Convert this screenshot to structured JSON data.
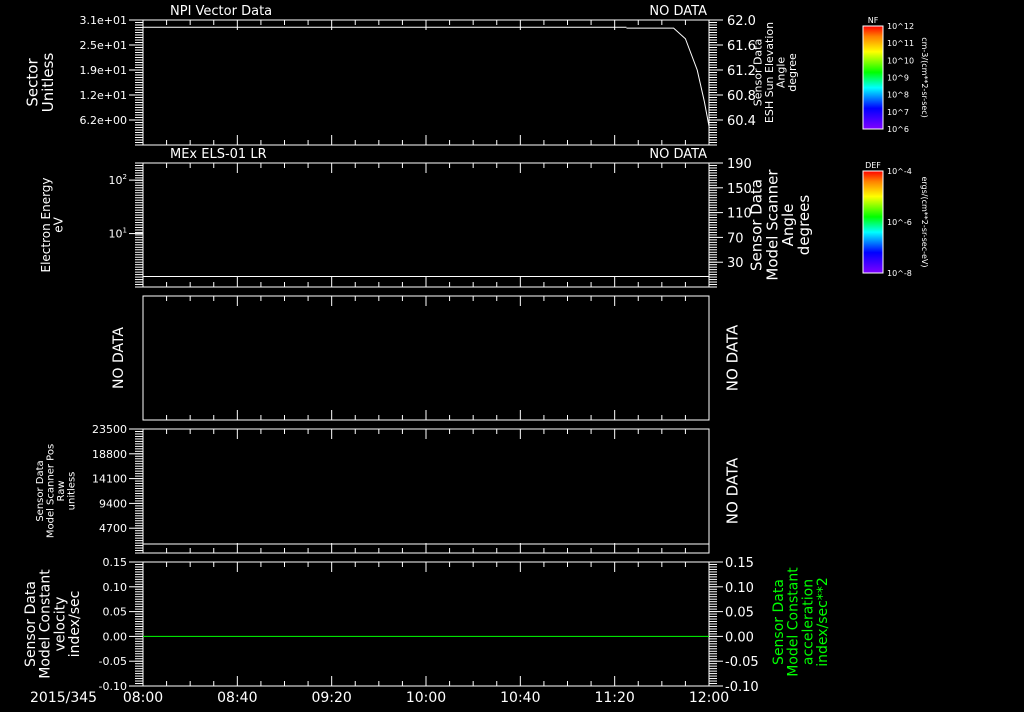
{
  "chart_data": [
    {
      "type": "line",
      "title": "NPI Vector Data",
      "status": "NO DATA",
      "ylabel": "Sector\nUnitless",
      "ylim": [
        0,
        31
      ],
      "yticks": [
        "3.1e+01",
        "2.5e+01",
        "1.9e+01",
        "1.2e+01",
        "6.2e+00"
      ],
      "ytick_values": [
        31,
        24.8,
        18.6,
        12.4,
        6.2
      ],
      "y2label": "Sensor Data\nESH Sun Elevation\nAngle\ndegree",
      "y2lim": [
        60.0,
        62.0
      ],
      "y2ticks": [
        "62.0",
        "61.6",
        "61.2",
        "60.8",
        "60.4"
      ],
      "y2tick_values": [
        62.0,
        61.6,
        61.2,
        60.8,
        60.4
      ],
      "series": [
        {
          "axis": "left",
          "x": [
            "08:00",
            "11:25"
          ],
          "y": [
            29.2,
            29.2
          ]
        },
        {
          "axis": "right",
          "x": [
            "11:25",
            "11:45",
            "11:50",
            "11:55",
            "11:58",
            "12:00"
          ],
          "y": [
            61.87,
            61.87,
            61.7,
            61.2,
            60.7,
            60.3
          ]
        }
      ]
    },
    {
      "type": "line",
      "title": "MEx ELS-01 LR",
      "status": "NO DATA",
      "ylabel": "Electron Energy\neV",
      "yscale": "log",
      "ylim": [
        1,
        209
      ],
      "yticks": [
        "10^2",
        "10^1"
      ],
      "ytick_values": [
        100,
        10
      ],
      "y2label": "Sensor Data\nModel Scanner\nAngle\ndegrees",
      "y2lim": [
        -10,
        190
      ],
      "y2ticks": [
        "190",
        "150",
        "110",
        "70",
        "30"
      ],
      "y2tick_values": [
        190,
        150,
        110,
        70,
        30
      ],
      "series": [
        {
          "axis": "right",
          "x": [
            "08:00",
            "12:00"
          ],
          "y": [
            7,
            7
          ]
        }
      ]
    },
    {
      "type": "line",
      "ylabel": "NO DATA",
      "y2label": "NO DATA",
      "series": []
    },
    {
      "type": "line",
      "ylabel": "Sensor Data\nModel Scanner Pos\nRaw\nunitless",
      "ylim": [
        0,
        23500
      ],
      "yticks": [
        "23500",
        "18800",
        "14100",
        "9400",
        "4700"
      ],
      "ytick_values": [
        23500,
        18800,
        14100,
        9400,
        4700
      ],
      "y2label": "NO DATA",
      "series": [
        {
          "axis": "left",
          "x": [
            "08:00",
            "12:00"
          ],
          "y": [
            1700,
            1700
          ]
        }
      ]
    },
    {
      "type": "line",
      "ylabel": "Sensor Data\nModel Constant\nvelocity\nindex/sec",
      "ylim": [
        -0.1,
        0.15
      ],
      "yticks": [
        "0.15",
        "0.10",
        "0.05",
        "0.00",
        "-0.05",
        "-0.10"
      ],
      "ytick_values": [
        0.15,
        0.1,
        0.05,
        0.0,
        -0.05,
        -0.1
      ],
      "y2label": "Sensor Data\nModel Constant\nacceleration\nindex/sec**2",
      "y2color": "#00ff00",
      "series": [
        {
          "axis": "right",
          "color": "#00ff00",
          "x": [
            "08:00",
            "12:00"
          ],
          "y": [
            0,
            0
          ]
        }
      ]
    }
  ],
  "x_axis": {
    "date": "2015/345",
    "ticks": [
      "08:00",
      "08:40",
      "09:20",
      "10:00",
      "10:40",
      "11:20",
      "12:00"
    ],
    "xlim": [
      "08:00",
      "12:00"
    ]
  },
  "colorbars": [
    {
      "title": "NF",
      "labels": [
        "10^12",
        "10^11",
        "10^10",
        "10^9",
        "10^8",
        "10^7",
        "10^6"
      ],
      "unit": "cm-3/(cm**2-sr-sec)",
      "scale": "log"
    },
    {
      "title": "DEF",
      "labels": [
        "10^-4",
        "10^-6",
        "10^-8"
      ],
      "unit": "ergs/(cm**2-sr-sec-eV)",
      "scale": "log"
    }
  ]
}
